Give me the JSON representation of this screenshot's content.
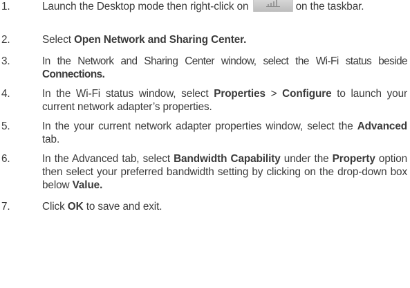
{
  "steps": [
    {
      "number": "1.",
      "before_icon": "Launch the Desktop mode then right-click on",
      "icon": "network-taskbar-icon",
      "after_icon": "on the taskbar."
    },
    {
      "number": "2.",
      "text": "Select ",
      "bold": "Open Network and Sharing Center."
    },
    {
      "number": "3.",
      "text": "In the Network and Sharing Center window, select the Wi-Fi status beside ",
      "bold": "Connections."
    },
    {
      "number": "4.",
      "t1": "In the Wi-Fi status window, select ",
      "b1": "Properties",
      "t2": " > ",
      "b2": "Configure",
      "t3": " to launch your current network adapter’s properties."
    },
    {
      "number": "5.",
      "t1": "In the your current network adapter properties window, select the ",
      "b1": "Advanced",
      "t2": " tab."
    },
    {
      "number": "6.",
      "t1": "In the Advanced tab, select ",
      "b1": "Bandwidth Capability",
      "t2": " under the ",
      "b2": "Property",
      "t3": " option then select your preferred bandwidth setting by clicking on the drop-down box below ",
      "b3": "Value."
    },
    {
      "number": "7.",
      "t1": "Click ",
      "b1": "OK",
      "t2": " to save and exit."
    }
  ]
}
